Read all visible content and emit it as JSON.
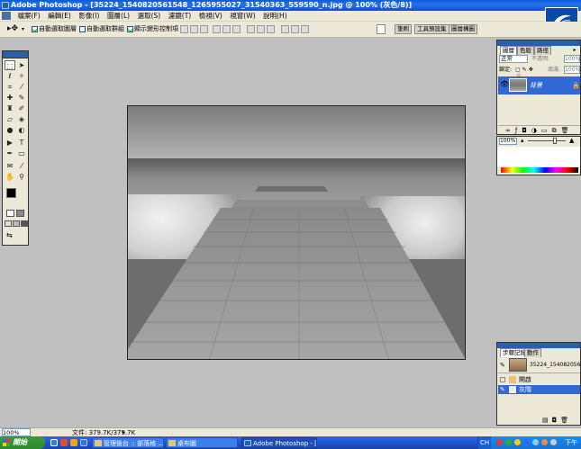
{
  "window": {
    "title": "Adobe Photoshop - [35224_1540820561548_1265955027_31540363_559590_n.jpg @ 100% (灰色/8)]",
    "controls": [
      "_",
      "□",
      "×"
    ]
  },
  "menubar": {
    "items": [
      {
        "label": "檔案(F)"
      },
      {
        "label": "編輯(E)"
      },
      {
        "label": "影像(I)"
      },
      {
        "label": "圖層(L)"
      },
      {
        "label": "選取(S)"
      },
      {
        "label": "濾鏡(T)"
      },
      {
        "label": "檢視(V)"
      },
      {
        "label": "視窗(W)"
      },
      {
        "label": "說明(H)"
      }
    ]
  },
  "options": {
    "auto_select_layer": {
      "label": "自動選取圖層",
      "checked": true
    },
    "auto_select_group": {
      "label": "自動選取群組",
      "checked": false
    },
    "show_transform": {
      "label": "顯示變形控制項",
      "checked": true
    }
  },
  "palette_well": {
    "tabs": [
      "筆刷",
      "工具預設集",
      "圖層構圖"
    ]
  },
  "layers_panel": {
    "tabs": [
      "圖層",
      "色版",
      "路徑"
    ],
    "blend_mode": "正常",
    "opacity_label": "不透明:",
    "opacity_value": "100%",
    "lock_label": "鎖定:",
    "fill_label": "填滿:",
    "fill_value": "100%",
    "layer_name": "背景"
  },
  "navigator_panel": {
    "zoom": "100%"
  },
  "history_panel": {
    "tabs": [
      "步驟記錄",
      "動作"
    ],
    "snapshot_name": "35224_1540820561548_...",
    "items": [
      {
        "label": "開啟",
        "selected": false
      },
      {
        "label": "灰階",
        "selected": true
      }
    ]
  },
  "statusbar": {
    "zoom": "100%",
    "doc_info": "文件: 379.7K/379.7K"
  },
  "taskbar": {
    "start_label": "開始",
    "buttons": [
      {
        "label": "管理後台 :: 部落格 ...",
        "active": false
      },
      {
        "label": "桌布圖",
        "active": false
      },
      {
        "label": "Adobe Photoshop - [3...",
        "active": true
      }
    ],
    "tray_lang": "CH",
    "clock": "下午"
  },
  "colors": {
    "title_blue": "#0a5adf",
    "taskbar_blue": "#245edb",
    "start_green": "#3c9a3c",
    "panel_bg": "#ece9d8",
    "workspace_gray": "#c0c0c0",
    "history_selected": "#3168d5"
  },
  "icons": [
    "photoshop-app-icon",
    "move-tool-icon",
    "marquee-tool-icon",
    "lasso-tool-icon",
    "crop-tool-icon",
    "brush-tool-icon",
    "eraser-tool-icon",
    "eye-icon",
    "trash-icon",
    "start-flag-icon"
  ]
}
